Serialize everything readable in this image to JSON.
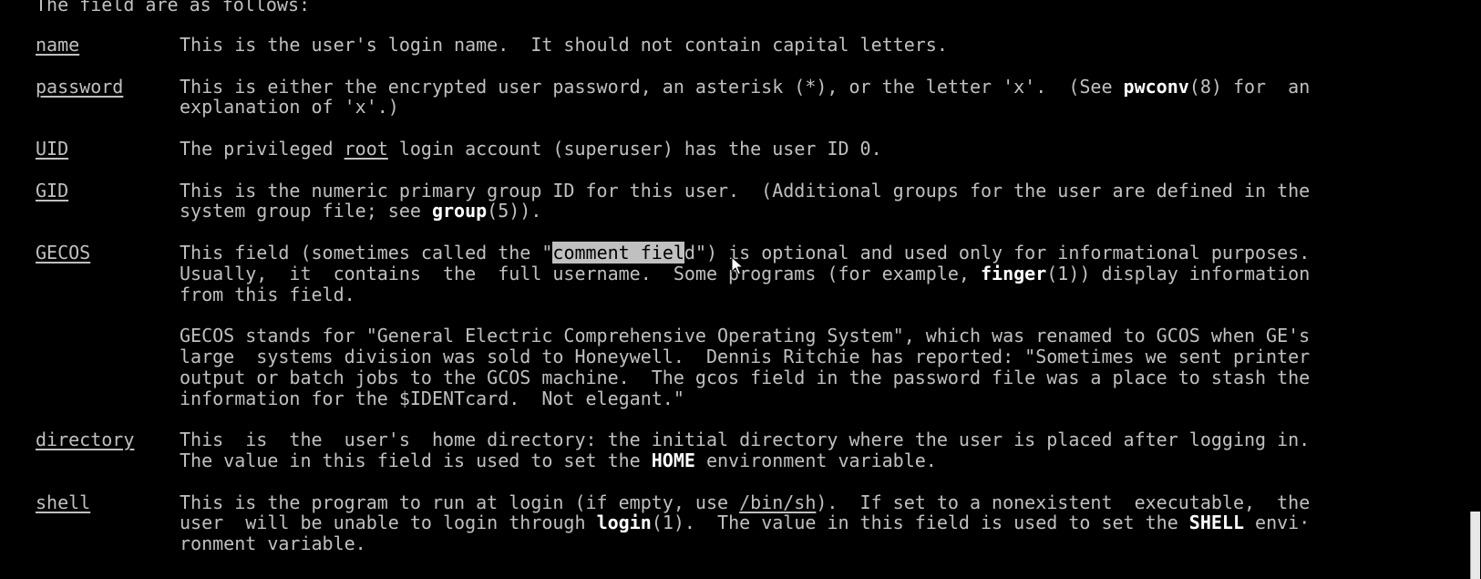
{
  "intro": "The field are as follows:",
  "entries": [
    {
      "term": "name",
      "lines": [
        [
          {
            "t": "This is the user's login name.  It should not contain capital letters."
          }
        ]
      ]
    },
    {
      "term": "password",
      "lines": [
        [
          {
            "t": "This is either the encrypted user password, an asterisk (*), or the letter 'x'.  (See "
          },
          {
            "t": "pwconv",
            "s": "b"
          },
          {
            "t": "(8) for  an"
          }
        ],
        [
          {
            "t": "explanation of 'x'.)"
          }
        ]
      ]
    },
    {
      "term": "UID",
      "lines": [
        [
          {
            "t": "The privileged "
          },
          {
            "t": "root",
            "s": "u"
          },
          {
            "t": " login account (superuser) has the user ID 0."
          }
        ]
      ]
    },
    {
      "term": "GID",
      "lines": [
        [
          {
            "t": "This is the numeric primary group ID for this user.  (Additional groups for the user are defined in the"
          }
        ],
        [
          {
            "t": "system group file; see "
          },
          {
            "t": "group",
            "s": "b"
          },
          {
            "t": "(5))."
          }
        ]
      ]
    },
    {
      "term": "GECOS",
      "lines": [
        [
          {
            "t": "This field (sometimes called the \""
          },
          {
            "t": "comment fiel",
            "s": "hl"
          },
          {
            "t": "d\") is optional and used only for informational purposes."
          }
        ],
        [
          {
            "t": "Usually,  it  contains  the  full username.  Some programs (for example, "
          },
          {
            "t": "finger",
            "s": "b"
          },
          {
            "t": "(1)) display information"
          }
        ],
        [
          {
            "t": "from this field."
          }
        ],
        [],
        [
          {
            "t": "GECOS stands for \"General Electric Comprehensive Operating System\", which was renamed to GCOS when GE's"
          }
        ],
        [
          {
            "t": "large  systems division was sold to Honeywell.  Dennis Ritchie has reported: \"Sometimes we sent printer"
          }
        ],
        [
          {
            "t": "output or batch jobs to the GCOS machine.  The gcos field in the password file was a place to stash the"
          }
        ],
        [
          {
            "t": "information for the $IDENTcard.  Not elegant.\""
          }
        ]
      ]
    },
    {
      "term": "directory",
      "lines": [
        [
          {
            "t": "This  is  the  user's  home directory: the initial directory where the user is placed after logging in."
          }
        ],
        [
          {
            "t": "The value in this field is used to set the "
          },
          {
            "t": "HOME",
            "s": "b"
          },
          {
            "t": " environment variable."
          }
        ]
      ]
    },
    {
      "term": "shell",
      "lines": [
        [
          {
            "t": "This is the program to run at login (if empty, use "
          },
          {
            "t": "/bin/sh",
            "s": "u"
          },
          {
            "t": ").  If set to a nonexistent  executable,  the"
          }
        ],
        [
          {
            "t": "user  will be unable to login through "
          },
          {
            "t": "login",
            "s": "b"
          },
          {
            "t": "(1).  The value in this field is used to set the "
          },
          {
            "t": "SHELL",
            "s": "b"
          },
          {
            "t": " envi·"
          }
        ],
        [
          {
            "t": "ronment variable."
          }
        ]
      ]
    }
  ],
  "colors": {
    "background": "#000000",
    "text": "#c0c0c0",
    "bold_text": "#ffffff",
    "selection_bg": "#c0c0c0",
    "selection_fg": "#000000"
  }
}
